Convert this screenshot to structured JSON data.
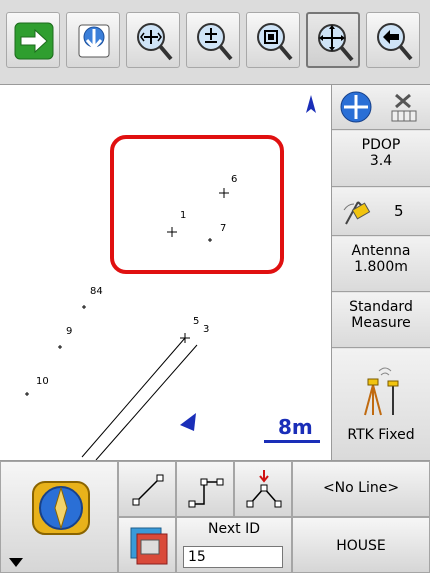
{
  "toolbar": {
    "buttons": [
      {
        "name": "go-forward"
      },
      {
        "name": "download"
      },
      {
        "name": "zoom-extents"
      },
      {
        "name": "zoom-in-out"
      },
      {
        "name": "zoom-window"
      },
      {
        "name": "pan"
      },
      {
        "name": "back"
      }
    ]
  },
  "map": {
    "points": [
      {
        "label": "6"
      },
      {
        "label": "1"
      },
      {
        "label": "7"
      },
      {
        "label": "84"
      },
      {
        "label": "9"
      },
      {
        "label": "5"
      },
      {
        "label": "3"
      },
      {
        "label": "10"
      }
    ],
    "scale": "8m"
  },
  "status": {
    "pdop_label": "PDOP",
    "pdop_value": "3.4",
    "satellites": "5",
    "antenna_label": "Antenna",
    "antenna_value": "1.800m",
    "measure_label_1": "Standard",
    "measure_label_2": "Measure",
    "rtk": "RTK Fixed"
  },
  "bottom": {
    "line": "<No Line>",
    "next_id_label": "Next ID",
    "next_id_value": "15",
    "code": "HOUSE"
  },
  "colors": {
    "highlight_box": "#e01010",
    "scale": "#1a2eb8",
    "north": "#1a2eb8"
  }
}
